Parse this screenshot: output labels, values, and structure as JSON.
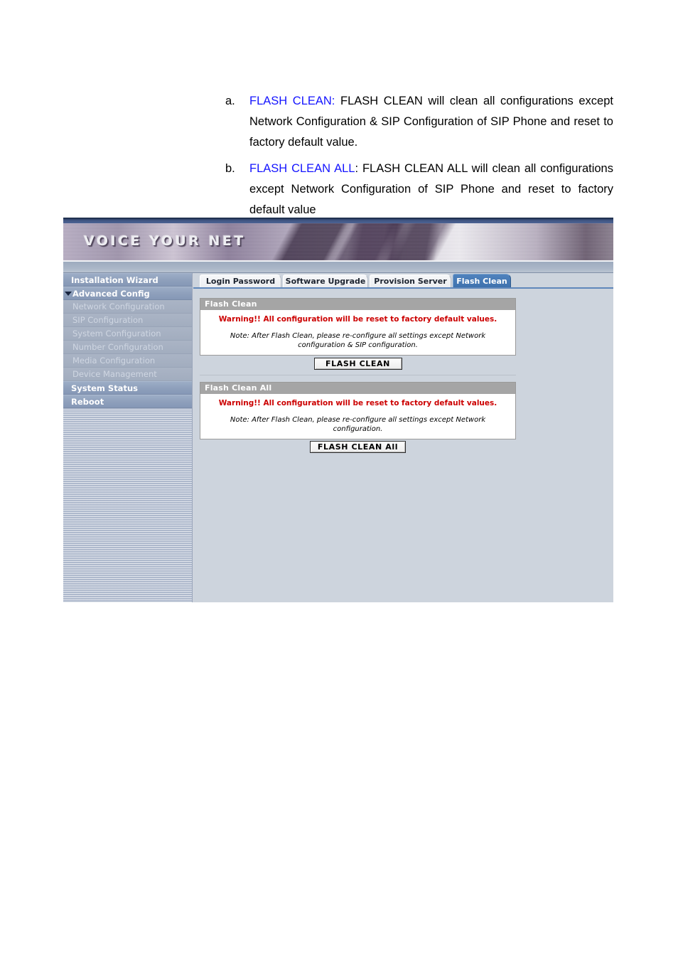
{
  "document": {
    "items": [
      {
        "marker": "a.",
        "term": "FLASH CLEAN:",
        "body": " FLASH CLEAN will clean all configurations except Network Configuration & SIP Configuration of SIP Phone and reset to factory default value."
      },
      {
        "marker": "b.",
        "term": "FLASH CLEAN ALL",
        "body": ": FLASH CLEAN ALL will clean all configurations except Network Configuration of SIP Phone and reset to factory default value"
      }
    ],
    "link_color": "#1414ff"
  },
  "screenshot": {
    "banner": {
      "wordmark": "VOICE YOUR NET"
    },
    "sidebar": {
      "items": [
        {
          "label": "Installation Wizard",
          "level": "top",
          "arrow": false
        },
        {
          "label": "Advanced Config",
          "level": "top",
          "arrow": true
        },
        {
          "label": "Network Configuration",
          "level": "sub",
          "arrow": false
        },
        {
          "label": "SIP Configuration",
          "level": "sub",
          "arrow": false
        },
        {
          "label": "System Configuration",
          "level": "sub",
          "arrow": false
        },
        {
          "label": "Number Configuration",
          "level": "sub",
          "arrow": false
        },
        {
          "label": "Media Configuration",
          "level": "sub",
          "arrow": false
        },
        {
          "label": "Device Management",
          "level": "sub",
          "arrow": false
        },
        {
          "label": "System Status",
          "level": "top",
          "arrow": false
        },
        {
          "label": "Reboot",
          "level": "top",
          "arrow": false
        }
      ]
    },
    "tabs": [
      {
        "label": "Login Password",
        "active": false
      },
      {
        "label": "Software Upgrade",
        "active": false
      },
      {
        "label": "Provision Server",
        "active": false
      },
      {
        "label": "Flash Clean",
        "active": true
      }
    ],
    "panels": [
      {
        "title": "Flash Clean",
        "warning": "Warning!! All configuration will be reset to factory default values.",
        "note": "Note: After Flash Clean, please re-configure all settings except Network configuration & SIP configuration.",
        "button": "FLASH CLEAN"
      },
      {
        "title": "Flash Clean All",
        "warning": "Warning!! All configuration will be reset to factory default values.",
        "note": "Note: After Flash Clean, please re-configure all settings except Network configuration.",
        "button": "FLASH CLEAN All"
      }
    ],
    "colors": {
      "tab_active": "#3f72ae",
      "panel_header": "#a5a5a5",
      "warning": "#cc0000",
      "sidebar": "#bfc8d8",
      "content": "#cdd4dd"
    }
  }
}
